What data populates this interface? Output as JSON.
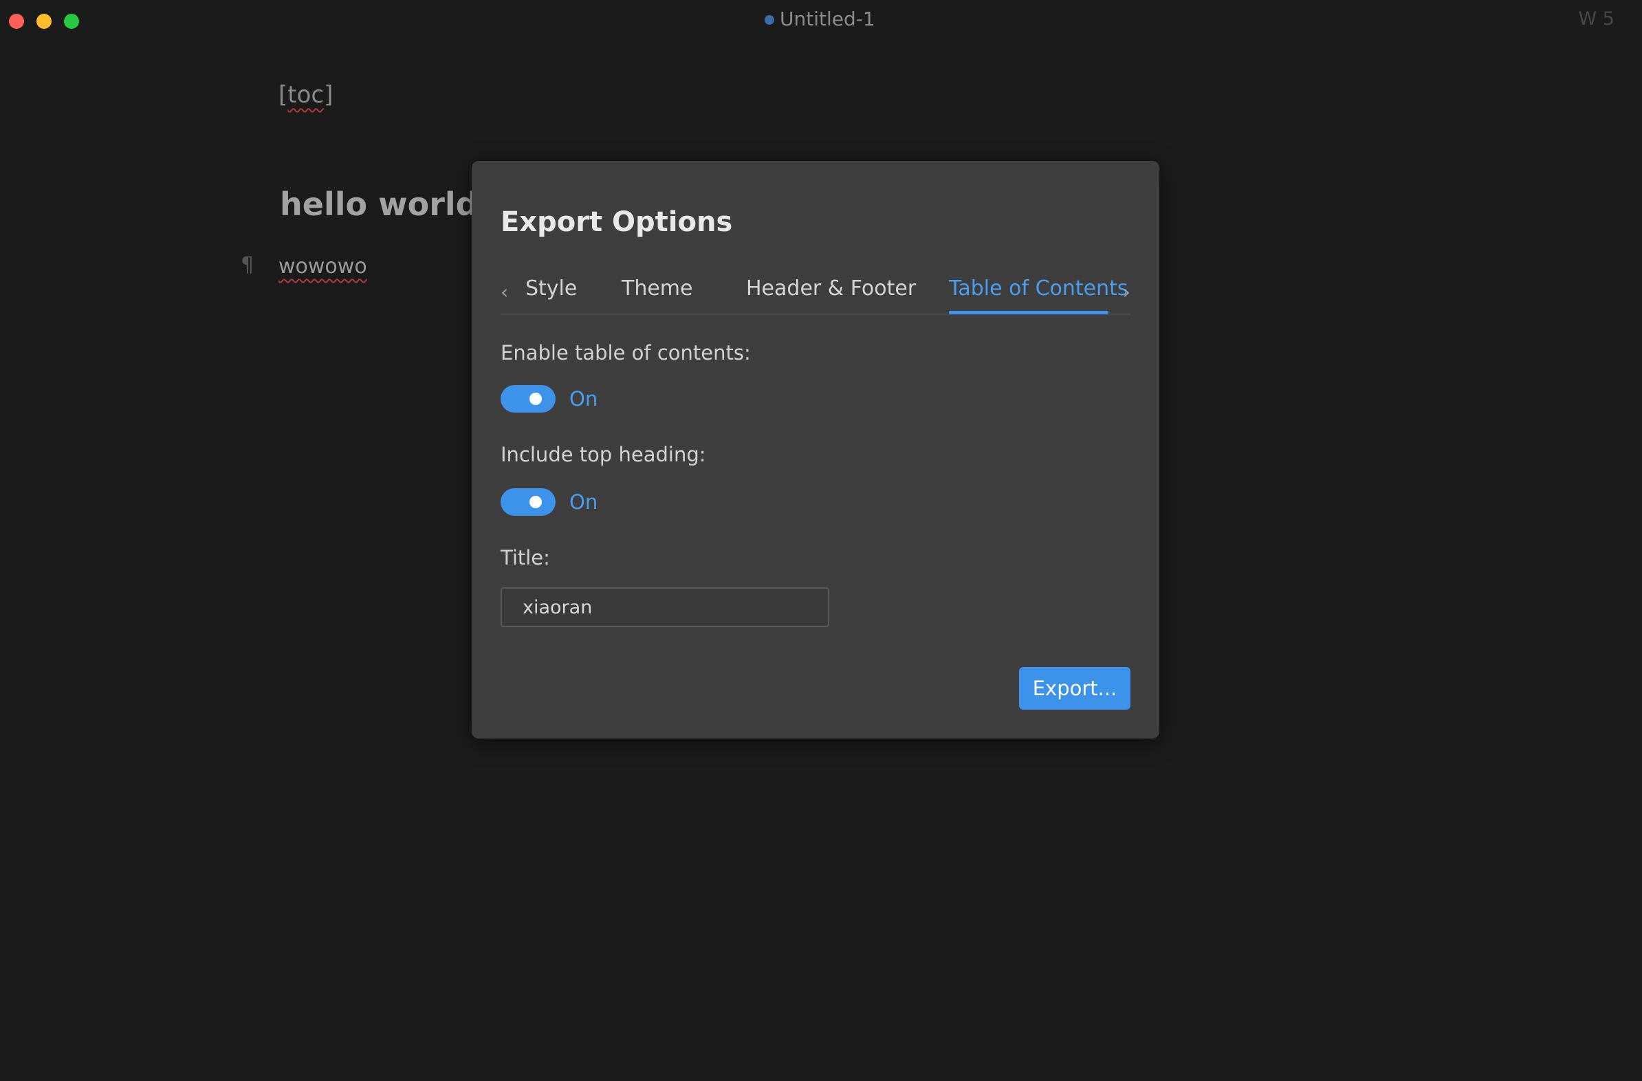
{
  "window": {
    "title": "Untitled-1",
    "word_count": "W 5"
  },
  "editor": {
    "toc_open": "[",
    "toc_word": "toc",
    "toc_close": "]",
    "heading": "hello world",
    "pilcrow": "¶",
    "paragraph": "wowowo"
  },
  "dialog": {
    "title": "Export Options",
    "tabs": [
      {
        "label": "Style"
      },
      {
        "label": "Theme"
      },
      {
        "label": "Header & Footer"
      },
      {
        "label": "Table of Contents"
      }
    ],
    "active_tab": "Table of Contents",
    "enable_toc": {
      "label": "Enable table of contents:",
      "state": "On"
    },
    "include_top": {
      "label": "Include top heading:",
      "state": "On"
    },
    "title_field": {
      "label": "Title:",
      "value": "xiaoran"
    },
    "export_label": "Export..."
  },
  "colors": {
    "accent": "#3d93ea",
    "background": "#1b1b1b",
    "dialog": "#3e3e3e"
  }
}
